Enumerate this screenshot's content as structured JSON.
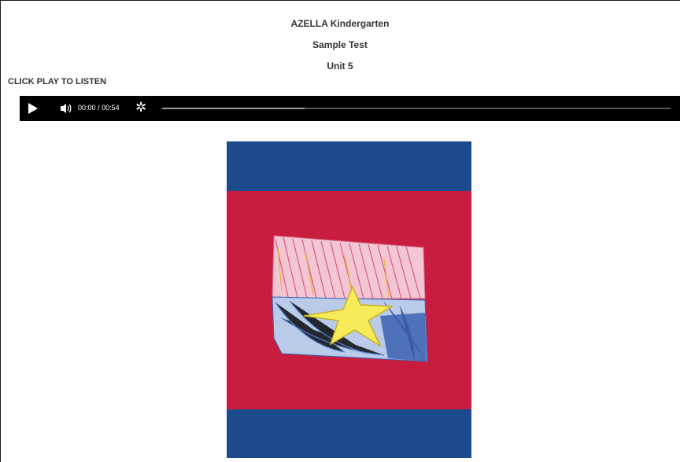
{
  "header": {
    "title_1": "AZELLA Kindergarten",
    "title_2": "Sample Test",
    "title_3": "Unit 5"
  },
  "instruction": "CLICK PLAY TO LISTEN",
  "audio_player": {
    "current_time": "00:00",
    "separator": "/",
    "duration": "00:54",
    "buffered_fraction": 0.28,
    "icons": [
      "play-icon",
      "volume-icon",
      "gear-icon"
    ]
  },
  "image": {
    "subject": "child-drawing-flag",
    "colors": {
      "panel_blue": "#1c4a8c",
      "panel_red": "#c81d3f",
      "drawing_pink": "#e87fa0",
      "drawing_blue": "#4a7fd0",
      "drawing_yellow": "#f4e23a"
    }
  }
}
